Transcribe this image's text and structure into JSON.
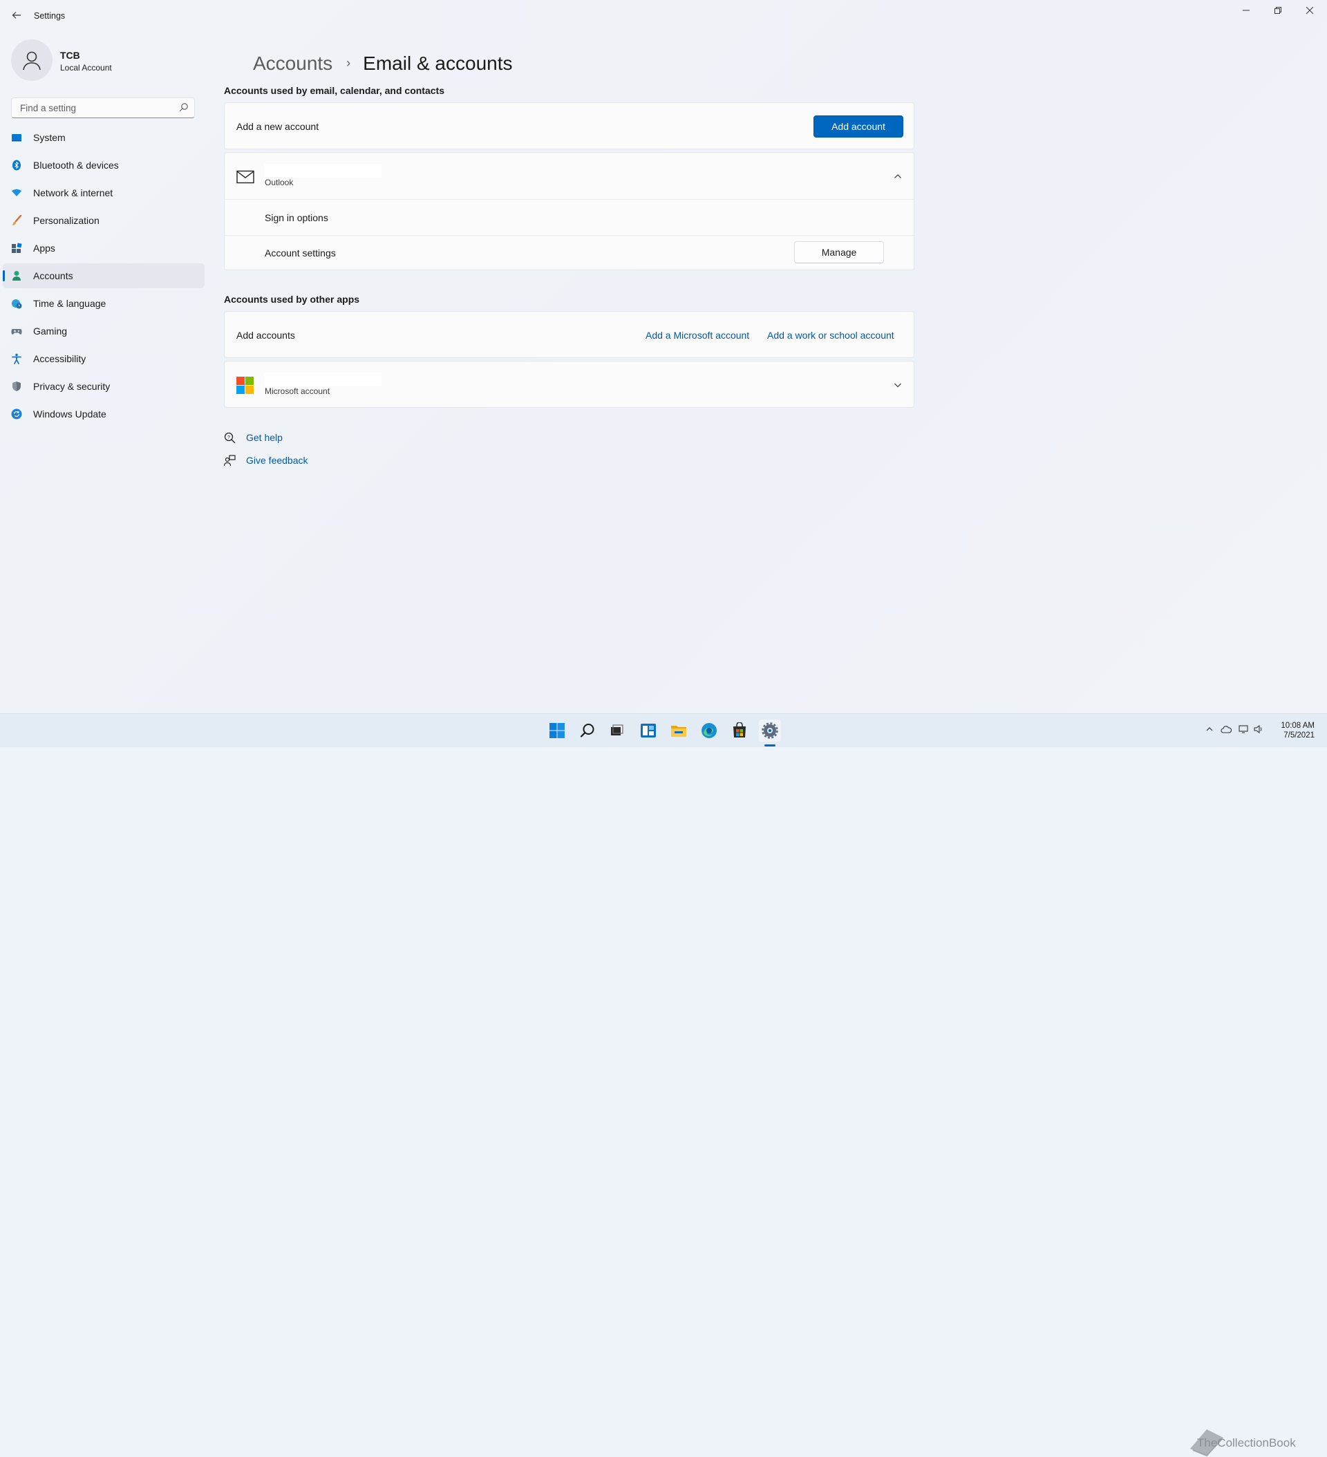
{
  "titlebar": {
    "app_title": "Settings",
    "back_label": "←",
    "minimize": "—",
    "maximize": "❐",
    "close": "✕"
  },
  "profile": {
    "name": "TCB",
    "type": "Local Account"
  },
  "search": {
    "placeholder": "Find a setting"
  },
  "sidebar": {
    "items": [
      {
        "label": "System",
        "icon": "system-icon",
        "active": false
      },
      {
        "label": "Bluetooth & devices",
        "icon": "bluetooth-icon",
        "active": false
      },
      {
        "label": "Network & internet",
        "icon": "network-icon",
        "active": false
      },
      {
        "label": "Personalization",
        "icon": "brush-icon",
        "active": false
      },
      {
        "label": "Apps",
        "icon": "apps-icon",
        "active": false
      },
      {
        "label": "Accounts",
        "icon": "person-icon",
        "active": true
      },
      {
        "label": "Time & language",
        "icon": "globe-clock-icon",
        "active": false
      },
      {
        "label": "Gaming",
        "icon": "gamepad-icon",
        "active": false
      },
      {
        "label": "Accessibility",
        "icon": "accessibility-icon",
        "active": false
      },
      {
        "label": "Privacy & security",
        "icon": "shield-icon",
        "active": false
      },
      {
        "label": "Windows Update",
        "icon": "update-icon",
        "active": false
      }
    ]
  },
  "breadcrumb": {
    "parent": "Accounts",
    "separator": "›",
    "current": "Email & accounts"
  },
  "email_section": {
    "heading": "Accounts used by email, calendar, and contacts",
    "add_row_label": "Add a new account",
    "add_button": "Add account",
    "account_provider": "Outlook",
    "sign_in_options": "Sign in options",
    "account_settings": "Account settings",
    "manage_button": "Manage"
  },
  "other_section": {
    "heading": "Accounts used by other apps",
    "add_row_label": "Add accounts",
    "add_microsoft_link": "Add a Microsoft account",
    "add_work_link": "Add a work or school account",
    "account_provider": "Microsoft account"
  },
  "help": {
    "get_help": "Get help",
    "give_feedback": "Give feedback"
  },
  "taskbar": {
    "icons": [
      "windows-start-icon",
      "search-icon",
      "task-view-icon",
      "widgets-icon",
      "file-explorer-icon",
      "edge-icon",
      "store-icon",
      "settings-icon"
    ],
    "clock_time": "10:08 AM",
    "clock_date": "7/5/2021",
    "watermark": "TheCollectionBook"
  },
  "colors": {
    "accent": "#0067c0",
    "background": "#eef3f9",
    "card": "#fbfbfc"
  }
}
